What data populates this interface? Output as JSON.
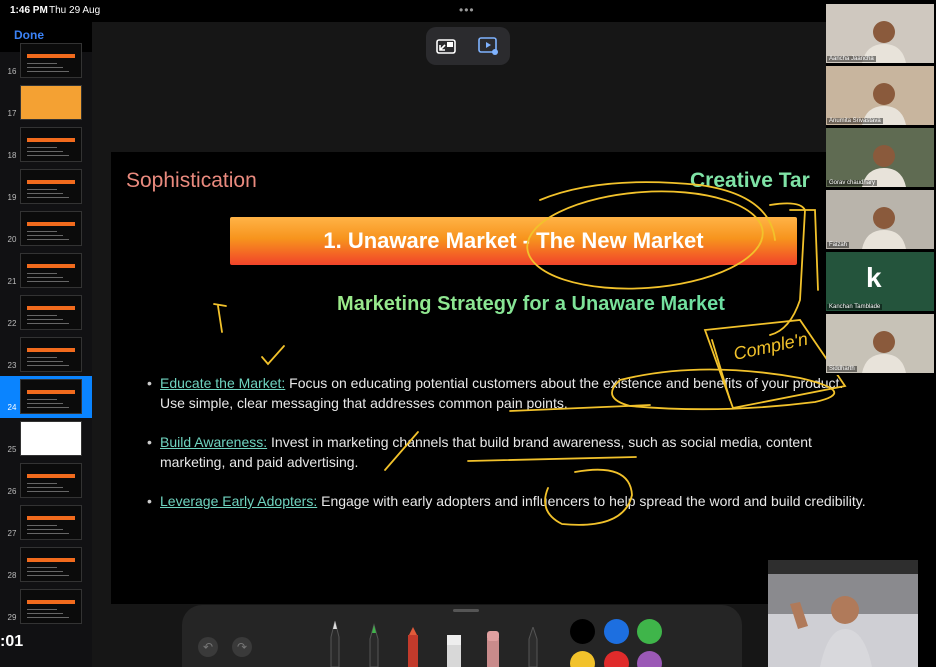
{
  "status": {
    "time": "1:46 PM",
    "date": "Thu 29 Aug",
    "dots": "•••"
  },
  "done_label": "Done",
  "top_controls": [
    {
      "name": "minimize-icon"
    },
    {
      "name": "screen-record-icon"
    }
  ],
  "sidebar": {
    "slides": [
      {
        "num": "16",
        "style": "dark"
      },
      {
        "num": "17",
        "style": "orange"
      },
      {
        "num": "18",
        "style": "dark"
      },
      {
        "num": "19",
        "style": "dark"
      },
      {
        "num": "20",
        "style": "dark"
      },
      {
        "num": "21",
        "style": "dark"
      },
      {
        "num": "22",
        "style": "dark"
      },
      {
        "num": "23",
        "style": "dark"
      },
      {
        "num": "24",
        "style": "dark",
        "selected": true
      },
      {
        "num": "25",
        "style": "white"
      },
      {
        "num": "26",
        "style": "dark"
      },
      {
        "num": "27",
        "style": "dark"
      },
      {
        "num": "28",
        "style": "dark"
      },
      {
        "num": "29",
        "style": "dark"
      }
    ]
  },
  "slide": {
    "title_left": "Sophistication",
    "title_right": "Creative Tar",
    "banner": "1. Unaware Market - The New Market",
    "subtitle": "Marketing Strategy for a Unaware Market",
    "bullets": [
      {
        "key": "Educate the Market:",
        "text": " Focus on educating potential customers about the existence and benefits of your product. Use simple, clear messaging that addresses common pain points."
      },
      {
        "key": "Build Awareness:",
        "text": " Invest in marketing channels that build brand awareness, such as social media, content marketing, and paid advertising."
      },
      {
        "key": "Leverage Early Adopters:",
        "text": " Engage with early adopters and influencers to help spread the word and build credibility."
      }
    ],
    "handwriting": "Comple'n"
  },
  "participants": [
    {
      "label": "Aancha Jaancha",
      "bg": "#cfc8bf"
    },
    {
      "label": "Anumita Srivastava",
      "bg": "#c8b59e"
    },
    {
      "label": "Gorav chaudhary",
      "bg": "#5f6b52"
    },
    {
      "label": "Faizah",
      "bg": "#b9b4ab"
    },
    {
      "label": "Kanchan Tamblade",
      "bg": "#24543c",
      "letter": "k"
    },
    {
      "label": "Siddharth",
      "bg": "#c7c2b7"
    }
  ],
  "toolbar": {
    "undo": "↶",
    "redo": "↷",
    "colors": [
      "#000000",
      "#1d6fe0",
      "#3fb54a",
      "#f2c22b",
      "#e02b2b",
      "#9b59b6"
    ]
  },
  "timer": ":01"
}
